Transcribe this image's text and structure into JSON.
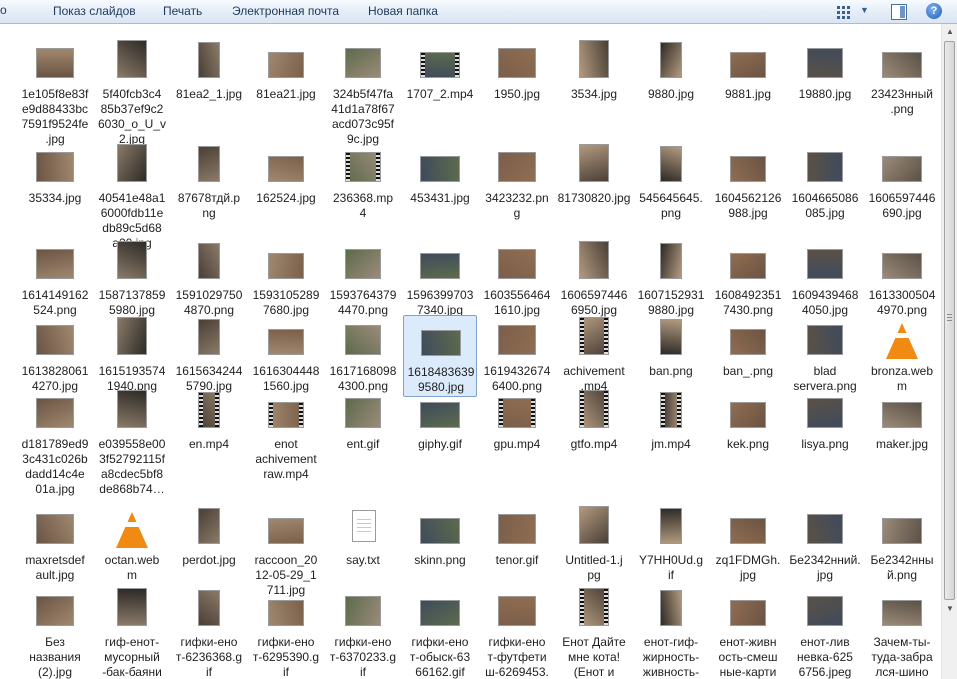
{
  "toolbar": {
    "left": "о",
    "items": [
      "Показ слайдов",
      "Печать",
      "Электронная почта",
      "Новая папка"
    ],
    "view_icon": "view-icon",
    "more_icon": "chevron-down-icon",
    "pane_icon": "preview-pane-icon",
    "help": "?"
  },
  "files": [
    "1e105f8e83fe9d88433bc7591f9524fe.jpg",
    "5f40fcb3c485b37ef9c26030_o_U_v2.jpg",
    "81ea2_1.jpg",
    "81ea21.jpg",
    "324b5f47fa41d1a78f67acd073c95f9c.jpg",
    "1707_2.mp4",
    "1950.jpg",
    "3534.jpg",
    "9880.jpg",
    "9881.jpg",
    "19880.jpg",
    "23423нный.png",
    "35334.jpg",
    "40541e48a16000fdb11edb89c5d68a20.jpg",
    "87678тдй.png",
    "162524.jpg",
    "236368.mp4",
    "453431.jpg",
    "3423232.png",
    "81730820.jpg",
    "545645645.png",
    "1604562126988.jpg",
    "1604665086085.jpg",
    "1606597446690.jpg",
    "1614149162524.png",
    "1587137859980.jpg",
    "1591029750487.png",
    "1593105289768.png",
    "1593764379447.png",
    "1596399703734.png",
    "1603556464161.png",
    "1606597446695.png",
    "1607152931988.png",
    "1608492351743.png",
    "1609439468405.png",
    "1613300504497.png",
    "1613828061427.png",
    "1615193574194.png",
    "1615634244579.jpg",
    "1616304448156.jpg",
    "1617168098430.png",
    "1618483639958.jpg",
    "1619432674640.png",
    "achivement.mp4",
    "ban.png",
    "ban_.png",
    "blad servera.png",
    "bronza.webm",
    "d181789ed93c431c026bdadd14c4e01a.jpg",
    "e039558e003f52792115fa8cdec5bf8de868b74…",
    "en.mp4",
    "enot achivement raw.mp4",
    "ent.gif",
    "giphy.gif",
    "gpu.mp4",
    "gtfo.mp4",
    "jm.mp4",
    "kek.png",
    "lisya.png",
    "maker.jpg",
    "maxretsdefault.jpg",
    "octan.webm",
    "perdot.jpg",
    "raccoon_2012-05-29_1711.jpg",
    "say.txt",
    "skinn.png",
    "tenor.gif",
    "Untitled-1.jpg",
    "Y7HH0Ud.gif",
    "zq1FDMGh.jpg",
    "Бе2342нний.jpg",
    "Бе2342нный.png",
    "Без названия (2).jpg",
    "гиф-енот-мусорный-бак-баяные-63727…",
    "гифки-енот-6236368.gif",
    "гифки-енот-6295390.gif",
    "гифки-енот-6370233.gif",
    "гифки-енот-обыск-6366162.gif",
    "гифки-енот-футфетиш-6269453.gif",
    "Енот Дайте мне кота! (Енот и кот).mp4",
    "енот-гиф-жирность-живность-6561686.gif",
    "енот-живность-смешные-картинки-6490…",
    "енот-ливневка-6256756.jpeg",
    "Зачем-ты-туда-забрался-шино монтаж-…"
  ],
  "labels_display": [
    "1e105f8e83f\ne9d88433bc\n7591f9524fe\n.jpg",
    "5f40fcb3c4\n85b37ef9c2\n6030_o_U_v\n2.jpg",
    "81ea2_1.jpg",
    "81ea21.jpg",
    "324b5f47fa\n41d1a78f67\nacd073c95f\n9c.jpg",
    "1707_2.mp4",
    "1950.jpg",
    "3534.jpg",
    "9880.jpg",
    "9881.jpg",
    "19880.jpg",
    "23423нный\n.png",
    "35334.jpg",
    "40541e48a1\n6000fdb11e\ndb89c5d68\na20.jpg",
    "87678тдй.p\nng",
    "162524.jpg",
    "236368.mp\n4",
    "453431.jpg",
    "3423232.pn\ng",
    "81730820.jpg",
    "545645645.\npng",
    "1604562126\n988.jpg",
    "1604665086\n085.jpg",
    "1606597446\n690.jpg",
    "1614149162\n524.png",
    "1587137859\n5980.jpg",
    "1591029750\n4870.png",
    "1593105289\n7680.jpg",
    "1593764379\n4470.png",
    "1596399703\n7340.jpg",
    "1603556464\n1610.jpg",
    "1606597446\n6950.jpg",
    "1607152931\n9880.jpg",
    "1608492351\n7430.png",
    "1609439468\n4050.jpg",
    "1613300504\n4970.png",
    "1613828061\n4270.jpg",
    "1615193574\n1940.png",
    "1615634244\n5790.jpg",
    "1616304448\n1560.jpg",
    "1617168098\n4300.png",
    "1618483639\n9580.jpg",
    "1619432674\n6400.png",
    "achivement\n.mp4",
    "ban.png",
    "ban_.png",
    "blad\nservera.png",
    "bronza.web\nm",
    "d181789ed9\n3c431c026b\ndadd14c4e\n01a.jpg",
    "e039558e00\n3f52792115f\na8cdec5bf8\nde868b74…",
    "en.mp4",
    "enot\nachivement\nraw.mp4",
    "ent.gif",
    "giphy.gif",
    "gpu.mp4",
    "gtfo.mp4",
    "jm.mp4",
    "kek.png",
    "lisya.png",
    "maker.jpg",
    "maxretsdef\nault.jpg",
    "octan.web\nm",
    "perdot.jpg",
    "raccoon_20\n12-05-29_1\n711.jpg",
    "say.txt",
    "skinn.png",
    "tenor.gif",
    "Untitled-1.j\npg",
    "Y7HH0Ud.g\nif",
    "zq1FDMGh.\njpg",
    "Бе2342нний.\njpg",
    "Бе2342нны\nй.png",
    "Без\nназвания\n(2).jpg",
    "гиф-енот-\nмусорный\n-бак-баяни\nше-63727…",
    "гифки-ено\nт-6236368.g\nif",
    "гифки-ено\nт-6295390.g\nif",
    "гифки-ено\nт-6370233.g\nif",
    "гифки-ено\nт-обыск-63\n66162.gif",
    "гифки-ено\nт-футфети\nш-6269453.\ngif",
    "Енот Дайте\nмне кота!\n(Енот и\nкот).mp4",
    "енот-гиф-\nжирность-\nживность-\n6561686.gif",
    "енот-живн\nость-смеш\nные-карти\nнки-6490…",
    "енот-лив\nневка-625\n6756.jpeg",
    "Зачем-ты-\nтуда-забра\nлся-шино\nмонтаж-…"
  ],
  "selected_index": 41
}
